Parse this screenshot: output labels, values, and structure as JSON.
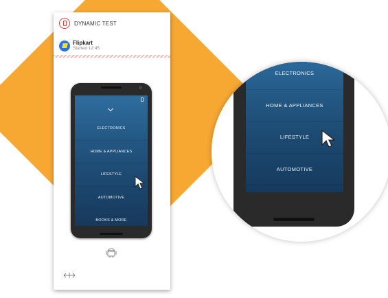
{
  "header": {
    "title": "DYNAMIC TEST",
    "logo_icon": "hourglass-logo-icon"
  },
  "app": {
    "name": "Flipkart",
    "started": "Started 12:45",
    "icon": "flipkart-logo-icon"
  },
  "device_menu": {
    "items": [
      {
        "label": "ELECTRONICS"
      },
      {
        "label": "HOME & APPLIANCES"
      },
      {
        "label": "LIFESTYLE"
      },
      {
        "label": "AUTOMOTIVE"
      },
      {
        "label": "BOOKS & MORE"
      }
    ]
  },
  "footer": {
    "platform_icon": "android-icon",
    "resize_icon": "resize-icon"
  },
  "colors": {
    "accent": "#f7a833",
    "screen": "#245a86",
    "brand_red": "#d9443a"
  }
}
